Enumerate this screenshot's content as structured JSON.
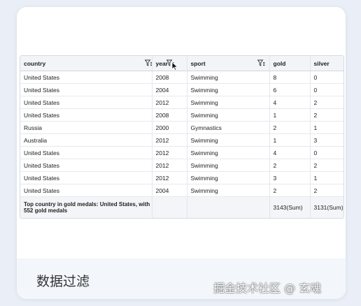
{
  "columns": [
    {
      "label": "country",
      "filter": true
    },
    {
      "label": "year",
      "filter": true
    },
    {
      "label": "sport",
      "filter": true
    },
    {
      "label": "gold",
      "filter": false
    },
    {
      "label": "silver",
      "filter": false
    }
  ],
  "rows": [
    [
      "United States",
      "2008",
      "Swimming",
      "8",
      "0"
    ],
    [
      "United States",
      "2004",
      "Swimming",
      "6",
      "0"
    ],
    [
      "United States",
      "2012",
      "Swimming",
      "4",
      "2"
    ],
    [
      "United States",
      "2008",
      "Swimming",
      "1",
      "2"
    ],
    [
      "Russia",
      "2000",
      "Gymnastics",
      "2",
      "1"
    ],
    [
      "Australia",
      "2012",
      "Swimming",
      "1",
      "3"
    ],
    [
      "United States",
      "2012",
      "Swimming",
      "4",
      "0"
    ],
    [
      "United States",
      "2012",
      "Swimming",
      "2",
      "2"
    ],
    [
      "United States",
      "2012",
      "Swimming",
      "3",
      "1"
    ],
    [
      "United States",
      "2004",
      "Swimming",
      "2",
      "2"
    ]
  ],
  "footer": {
    "summary": "Top country in gold medals: United States, with 552 gold medals",
    "gold_sum": "3143(Sum)",
    "silver_sum": "3131(Sum)"
  },
  "caption": "数据过滤",
  "watermark": "掘金技术社区 @ 玄魂",
  "icons": {
    "filter": "filter-icon",
    "cursor": "mouse-cursor-icon"
  }
}
